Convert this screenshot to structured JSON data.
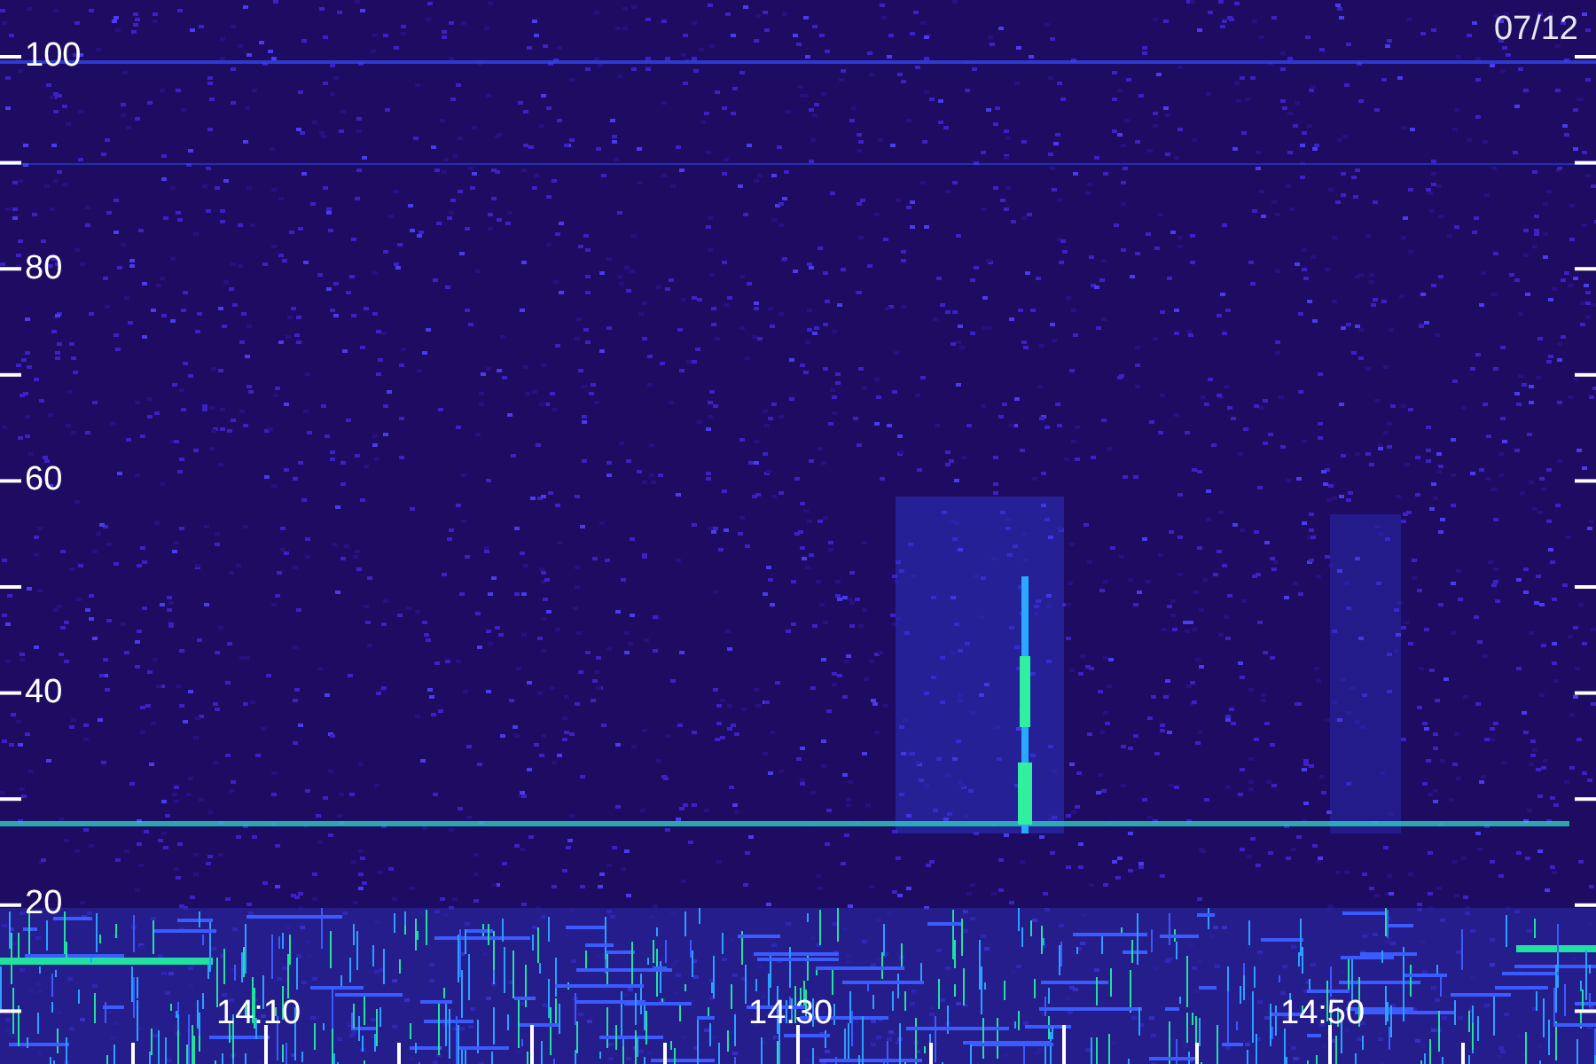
{
  "date": "07/12",
  "y_axis": {
    "labels": [
      "100",
      "80",
      "60",
      "40",
      "20"
    ]
  },
  "x_axis": {
    "labels": [
      "14:10",
      "14:30",
      "14:50"
    ]
  }
}
